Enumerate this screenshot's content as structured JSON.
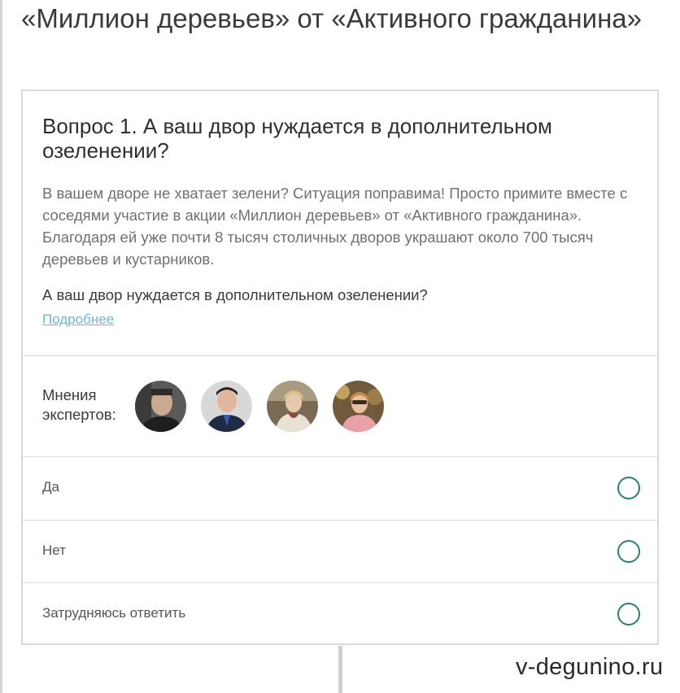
{
  "page": {
    "title": "«Миллион деревьев» от «Активного гражданина»"
  },
  "question": {
    "title": "Вопрос 1. А ваш двор нуждается в дополнительном озеленении?",
    "description": "В вашем дворе не хватает зелени? Ситуация поправима! Просто примите вместе с соседями участие в акции «Миллион деревьев» от «Активного гражданина». Благодаря ей уже почти 8 тысяч столичных дворов украшают около 700 тысяч деревьев и кустарников.",
    "prompt": "А ваш двор нуждается в дополнительном озеленении?",
    "more_link": "Подробнее"
  },
  "experts": {
    "label": "Мнения экспертов:",
    "avatars": [
      "expert-avatar-1",
      "expert-avatar-2",
      "expert-avatar-3",
      "expert-avatar-4"
    ]
  },
  "options": [
    {
      "label": "Да",
      "selected": false
    },
    {
      "label": "Нет",
      "selected": false
    },
    {
      "label": "Затрудняюсь ответить",
      "selected": false
    }
  ],
  "watermark": "v-degunino.ru",
  "colors": {
    "accent": "#2e7d74",
    "link": "#6fb8c9",
    "border": "#d9d9d9"
  }
}
